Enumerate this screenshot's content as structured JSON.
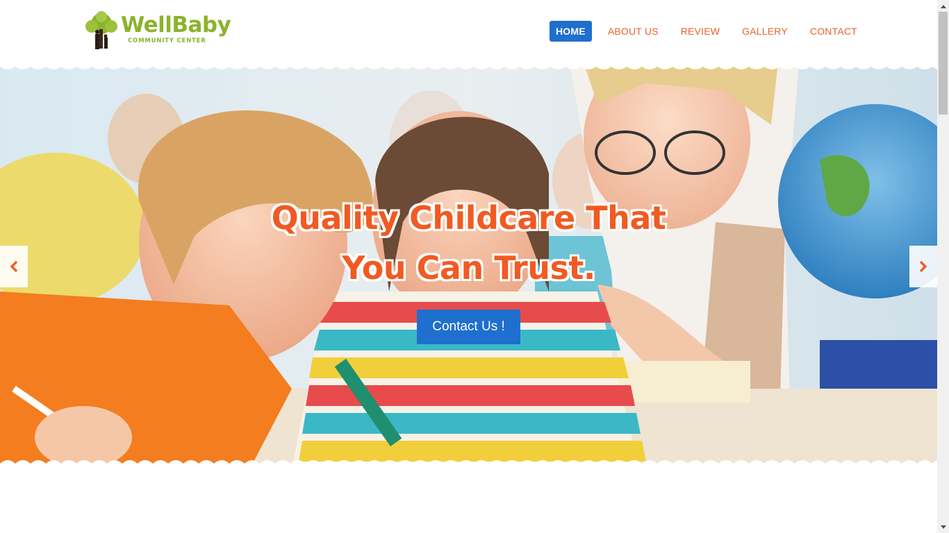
{
  "brand": {
    "name": "WellBaby",
    "tagline": "COMMUNITY CENTER",
    "color": "#8cb32b"
  },
  "nav": {
    "items": [
      {
        "label": "HOME",
        "active": true
      },
      {
        "label": "ABOUT US",
        "active": false
      },
      {
        "label": "REVIEW",
        "active": false
      },
      {
        "label": "GALLERY",
        "active": false
      },
      {
        "label": "CONTACT",
        "active": false
      }
    ],
    "accent": "#e8612c",
    "active_bg": "#1f6fce"
  },
  "hero": {
    "headline_line1": "Quality Childcare That",
    "headline_line2": "You Can Trust.",
    "cta_label": "Contact Us !",
    "prev_icon": "chevron-left-icon",
    "next_icon": "chevron-right-icon",
    "headline_color": "#f15a22"
  },
  "scrollbar": {
    "up_icon": "triangle-up-icon",
    "down_icon": "triangle-down-icon"
  }
}
